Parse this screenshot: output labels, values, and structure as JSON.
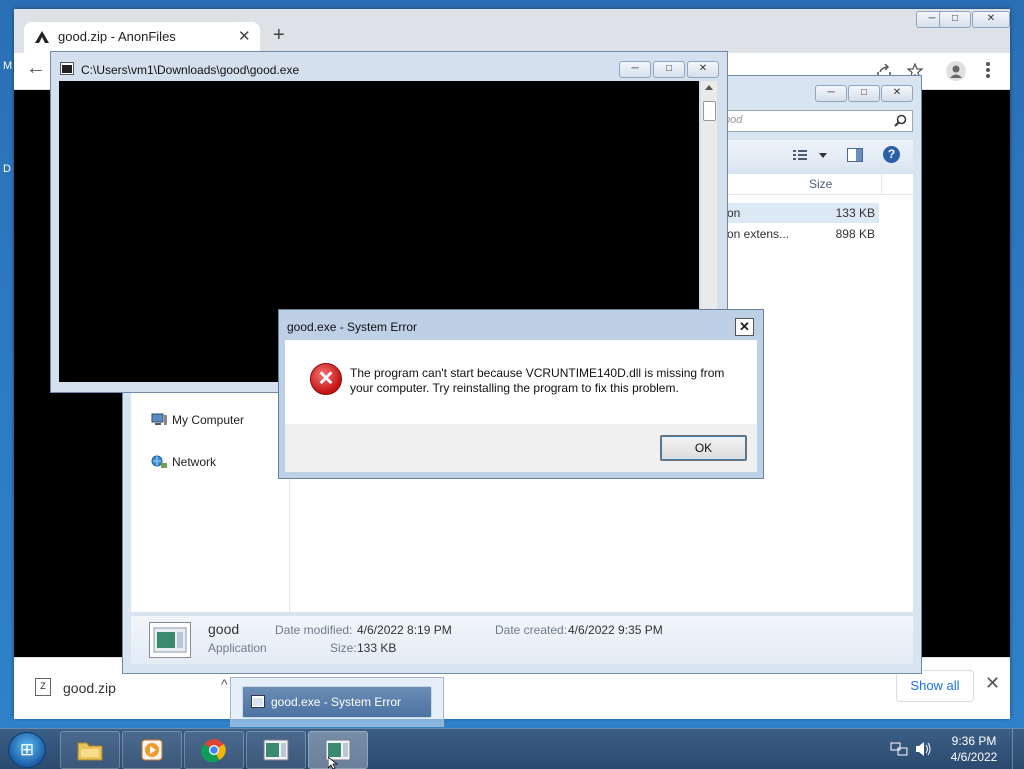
{
  "desktop": {
    "side_letters": [
      "M",
      "D"
    ]
  },
  "chrome": {
    "tab_title": "good.zip - AnonFiles",
    "tab_close": "✕",
    "new_tab": "+",
    "back": "←",
    "window_controls": [
      "─",
      "□",
      "✕"
    ],
    "toolbar_icons": [
      "share-icon",
      "star-icon",
      "account-icon",
      "menu-icon"
    ],
    "download": {
      "file_name": "good.zip",
      "chevron": "^",
      "show_all": "Show all",
      "close": "✕"
    }
  },
  "explorer": {
    "search_placeholder": "ood",
    "column_size": "Size",
    "rows": [
      {
        "type": "tion",
        "size": "133 KB"
      },
      {
        "type": "tion extens...",
        "size": "898 KB"
      }
    ],
    "nav": [
      {
        "label": "My Computer"
      },
      {
        "label": "Network"
      }
    ],
    "details": {
      "name": "good",
      "type": "Application",
      "date_modified_label": "Date modified:",
      "date_modified": "4/6/2022 8:19 PM",
      "size_label": "Size:",
      "size": "133 KB",
      "date_created_label": "Date created:",
      "date_created": "4/6/2022 9:35 PM"
    }
  },
  "console": {
    "title": "C:\\Users\\vm1\\Downloads\\good\\good.exe"
  },
  "dialog": {
    "title": "good.exe - System Error",
    "message": "The program can't start because VCRUNTIME140D.dll is missing from your computer. Try reinstalling the program to fix this problem.",
    "ok": "OK",
    "close": "✕"
  },
  "taskbar": {
    "preview_label": "good.exe - System Error",
    "time": "9:36 PM",
    "date": "4/6/2022",
    "buttons": [
      "windows-explorer",
      "media-player",
      "chrome",
      "good-exe",
      "good-exe-error"
    ]
  },
  "colors": {
    "desktop": "#2d79c2",
    "chrome_tabstrip": "#dee1e6",
    "link_blue": "#1a73e8",
    "error_red": "#c41212"
  }
}
